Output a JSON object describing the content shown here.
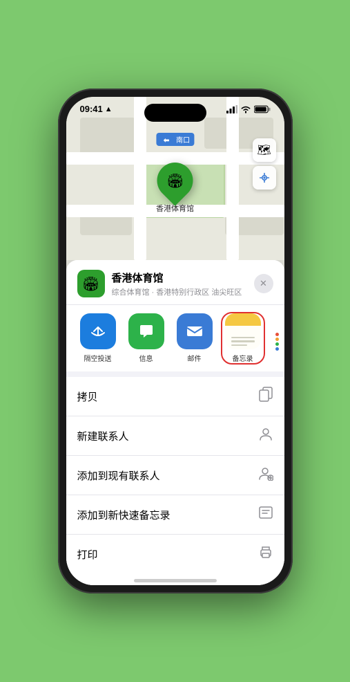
{
  "status_bar": {
    "time": "09:41",
    "location_arrow": "▶"
  },
  "map": {
    "nav_label": "南口",
    "pin_label": "香港体育馆",
    "controls": {
      "map_icon": "🗺",
      "location_icon": "➤"
    }
  },
  "sheet": {
    "venue_name": "香港体育馆",
    "venue_sub": "综合体育馆 · 香港特别行政区 油尖旺区",
    "close_label": "✕",
    "share_items": [
      {
        "id": "airdrop",
        "label": "隔空投送",
        "type": "airdrop"
      },
      {
        "id": "messages",
        "label": "信息",
        "type": "messages"
      },
      {
        "id": "mail",
        "label": "邮件",
        "type": "mail"
      },
      {
        "id": "notes",
        "label": "备忘录",
        "type": "notes"
      }
    ],
    "actions": [
      {
        "id": "copy",
        "label": "拷贝",
        "icon": "⎘"
      },
      {
        "id": "new-contact",
        "label": "新建联系人",
        "icon": "👤"
      },
      {
        "id": "add-existing",
        "label": "添加到现有联系人",
        "icon": "👤"
      },
      {
        "id": "quick-note",
        "label": "添加到新快速备忘录",
        "icon": "🖊"
      },
      {
        "id": "print",
        "label": "打印",
        "icon": "🖨"
      }
    ]
  }
}
